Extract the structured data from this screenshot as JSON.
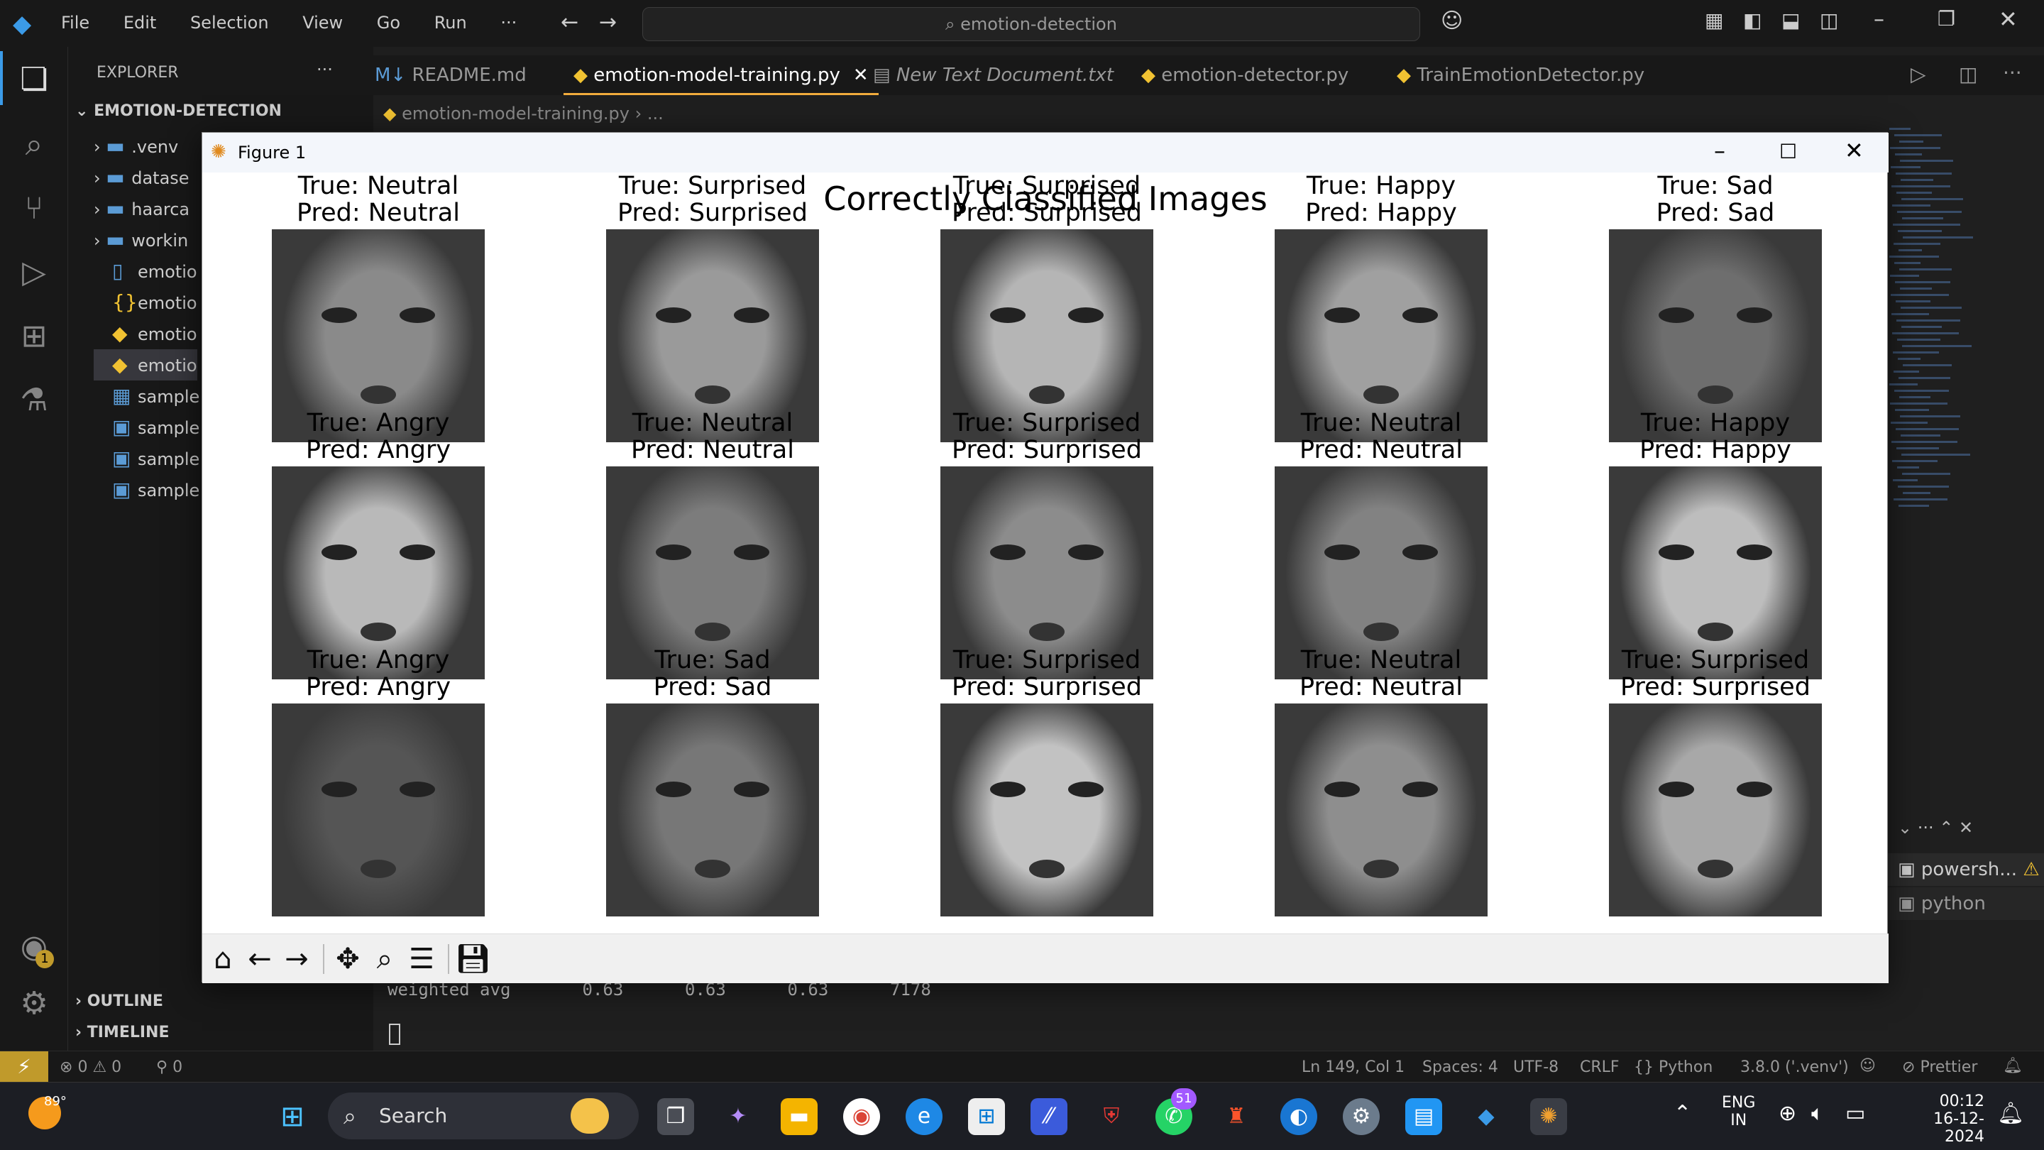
{
  "titlebar": {
    "menu": [
      "File",
      "Edit",
      "Selection",
      "View",
      "Go",
      "Run",
      "···"
    ],
    "search": "emotion-detection"
  },
  "explorer": {
    "header": "EXPLORER",
    "root": "EMOTION-DETECTION",
    "items": [
      {
        "label": ".venv",
        "icon": "folder-icon"
      },
      {
        "label": "datase",
        "icon": "folder-icon"
      },
      {
        "label": "haarca",
        "icon": "folder-icon"
      },
      {
        "label": "workin",
        "icon": "folder-icon"
      },
      {
        "label": "emotio",
        "icon": "file-icon"
      },
      {
        "label": "emotio",
        "icon": "json-icon"
      },
      {
        "label": "emotio",
        "icon": "python-icon"
      },
      {
        "label": "emotio",
        "icon": "python-icon"
      },
      {
        "label": "sample",
        "icon": "video-icon"
      },
      {
        "label": "sample",
        "icon": "image-icon"
      },
      {
        "label": "sample",
        "icon": "image-icon"
      },
      {
        "label": "sample",
        "icon": "image-icon"
      }
    ],
    "outline": "OUTLINE",
    "timeline": "TIMELINE"
  },
  "tabs": [
    {
      "label": "README.md",
      "active": false
    },
    {
      "label": "emotion-model-training.py",
      "active": true
    },
    {
      "label": "New Text Document.txt",
      "active": false
    },
    {
      "label": "emotion-detector.py",
      "active": false
    },
    {
      "label": "TrainEmotionDetector.py",
      "active": false
    }
  ],
  "breadcrumb": {
    "file": "emotion-model-training.py",
    "rest": "..."
  },
  "terminal": {
    "line": "weighted avg       0.63      0.63      0.63      7178",
    "panel_items": [
      "powersh...",
      "python"
    ]
  },
  "statusbar": {
    "problems": "0",
    "warnings": "0",
    "ports": "0",
    "position": "Ln 149, Col 1",
    "spaces": "Spaces: 4",
    "encoding": "UTF-8",
    "eol": "CRLF",
    "language": "Python",
    "interpreter": "3.8.0 ('.venv')",
    "prettier": "Prettier"
  },
  "taskbar": {
    "weather": "89°",
    "search": "Search",
    "whatsapp_badge": "51",
    "lang1": "ENG",
    "lang2": "IN",
    "time": "00:12",
    "date": "16-12-2024"
  },
  "figure": {
    "window_title": "Figure 1",
    "suptitle": "Correctly Classified Images",
    "cells": [
      {
        "true": "True: Neutral",
        "pred": "Pred: Neutral",
        "shade": "#8a8a8a"
      },
      {
        "true": "True: Surprised",
        "pred": "Pred: Surprised",
        "shade": "#9a9a9a"
      },
      {
        "true": "True: Surprised",
        "pred": "Pred: Surprised",
        "shade": "#b5b5b5"
      },
      {
        "true": "True: Happy",
        "pred": "Pred: Happy",
        "shade": "#a0a0a0"
      },
      {
        "true": "True: Sad",
        "pred": "Pred: Sad",
        "shade": "#6e6e6e"
      },
      {
        "true": "True: Angry",
        "pred": "Pred: Angry",
        "shade": "#b9b9b9"
      },
      {
        "true": "True: Neutral",
        "pred": "Pred: Neutral",
        "shade": "#7c7c7c"
      },
      {
        "true": "True: Surprised",
        "pred": "Pred: Surprised",
        "shade": "#8c8c8c"
      },
      {
        "true": "True: Neutral",
        "pred": "Pred: Neutral",
        "shade": "#828282"
      },
      {
        "true": "True: Happy",
        "pred": "Pred: Happy",
        "shade": "#bdbdbd"
      },
      {
        "true": "True: Angry",
        "pred": "Pred: Angry",
        "shade": "#555555"
      },
      {
        "true": "True: Sad",
        "pred": "Pred: Sad",
        "shade": "#777777"
      },
      {
        "true": "True: Surprised",
        "pred": "Pred: Surprised",
        "shade": "#c2c2c2"
      },
      {
        "true": "True: Neutral",
        "pred": "Pred: Neutral",
        "shade": "#8e8e8e"
      },
      {
        "true": "True: Surprised",
        "pred": "Pred: Surprised",
        "shade": "#a8a8a8"
      }
    ]
  }
}
